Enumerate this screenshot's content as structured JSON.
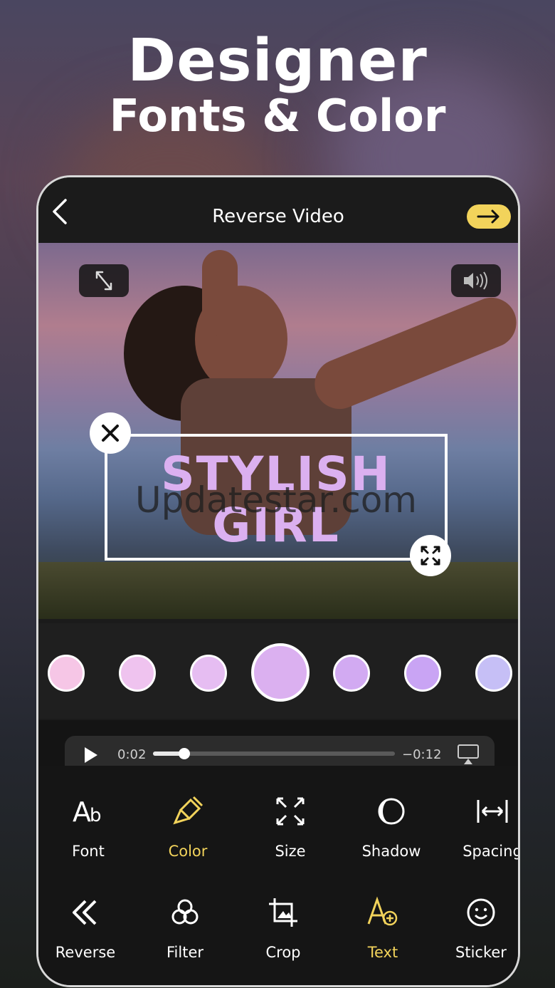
{
  "headline": {
    "line1": "Designer",
    "line2": "Fonts & Color"
  },
  "header": {
    "title": "Reverse Video"
  },
  "canvas": {
    "text_line1": "STYLISH",
    "text_line2": "GIRL",
    "text_color": "#dbb0f0",
    "watermark": "Updatestar.com"
  },
  "swatches": [
    {
      "color": "#f6c6e6",
      "selected": false
    },
    {
      "color": "#efc3ef",
      "selected": false
    },
    {
      "color": "#e6bdf2",
      "selected": false
    },
    {
      "color": "#dbb0f0",
      "selected": true
    },
    {
      "color": "#d2aaf2",
      "selected": false
    },
    {
      "color": "#c9a4f4",
      "selected": false
    },
    {
      "color": "#c6bff6",
      "selected": false
    }
  ],
  "player": {
    "elapsed": "0:02",
    "remaining": "−0:12",
    "progress": 0.13
  },
  "tools_row1": [
    {
      "label": "Font",
      "icon": "font-icon",
      "active": false
    },
    {
      "label": "Color",
      "icon": "paintbrush-icon",
      "active": true
    },
    {
      "label": "Size",
      "icon": "resize-icon",
      "active": false
    },
    {
      "label": "Shadow",
      "icon": "shadow-icon",
      "active": false
    },
    {
      "label": "Spacing",
      "icon": "spacing-icon",
      "active": false
    }
  ],
  "tools_row2": [
    {
      "label": "Reverse",
      "icon": "rewind-icon",
      "active": false
    },
    {
      "label": "Filter",
      "icon": "filter-icon",
      "active": false
    },
    {
      "label": "Crop",
      "icon": "crop-icon",
      "active": false
    },
    {
      "label": "Text",
      "icon": "add-text-icon",
      "active": true
    },
    {
      "label": "Sticker",
      "icon": "smiley-icon",
      "active": false
    }
  ],
  "colors": {
    "accent": "#f2d35b",
    "toolbar_bg": "#151515"
  }
}
